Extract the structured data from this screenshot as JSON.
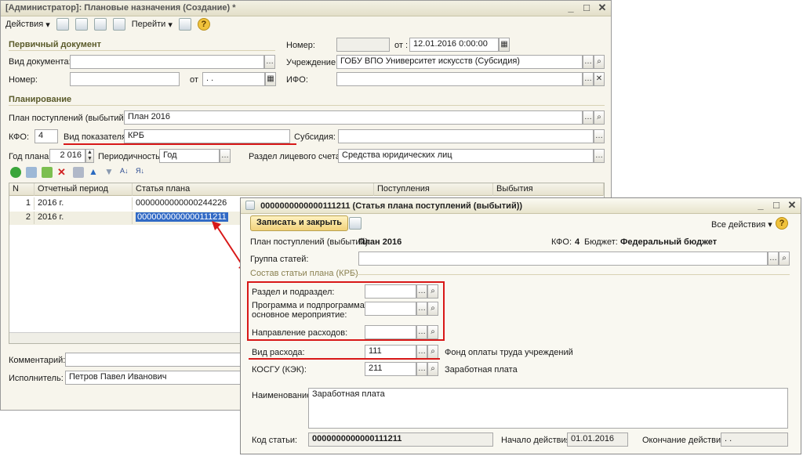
{
  "main_window": {
    "title": "[Администратор]: Плановые назначения (Создание) *",
    "toolbar": {
      "actions": "Действия",
      "go": "Перейти"
    },
    "primary_doc": {
      "section": "Первичный документ",
      "doc_type_label": "Вид документа:",
      "doc_type_value": "",
      "number_label": "Номер:",
      "number_value": "",
      "from_label": "от",
      "from_value": ". .",
      "num_label": "Номер:",
      "num_value": "",
      "ot_label": "от :",
      "date_value": "12.01.2016  0:00:00",
      "institution_label": "Учреждение:",
      "institution_value": "ГОБУ ВПО Университет искусств (Субсидия)",
      "ifo_label": "ИФО:",
      "ifo_value": ""
    },
    "planning": {
      "section": "Планирование",
      "plan_label": "План поступлений (выбытий):",
      "plan_value": "План 2016",
      "kfo_label": "КФО:",
      "kfo_value": "4",
      "indicator_label": "Вид показателя:",
      "indicator_value": "КРБ",
      "subsidy_label": "Субсидия:",
      "subsidy_value": "",
      "year_label": "Год плана:",
      "year_value": "2 016",
      "period_label": "Периодичность:",
      "period_value": "Год",
      "account_label": "Раздел лицевого счета:",
      "account_value": "Средства юридических лиц"
    },
    "table": {
      "headers": [
        "N",
        "Отчетный период",
        "Статья плана",
        "Поступления",
        "Выбытия"
      ],
      "rows": [
        {
          "n": "1",
          "period": "2016 г.",
          "article": "0000000000000244226"
        },
        {
          "n": "2",
          "period": "2016 г.",
          "article": "0000000000000111211"
        }
      ]
    },
    "comment_label": "Комментарий:",
    "comment_value": "",
    "executor_label": "Исполнитель:",
    "executor_value": "Петров Павел Иванович"
  },
  "dialog": {
    "title": "0000000000000111211 (Статья плана поступлений (выбытий))",
    "save_close": "Записать и закрыть",
    "all_actions": "Все действия",
    "plan_label": "План поступлений (выбытий):",
    "plan_value": "План 2016",
    "kfo_label": "КФО:",
    "kfo_value": "4",
    "budget_label": "Бюджет:",
    "budget_value": "Федеральный бюджет",
    "group_label": "Группа статей:",
    "group_value": "",
    "composition_section": "Состав статьи плана (КРБ)",
    "section_label": "Раздел и подраздел:",
    "section_value": "",
    "program_label_1": "Программа и подпрограмма,",
    "program_label_2": "основное мероприятие:",
    "program_value": "",
    "direction_label": "Направление расходов:",
    "direction_value": "",
    "expense_label": "Вид расхода:",
    "expense_value": "111",
    "expense_desc": "Фонд оплаты труда учреждений",
    "kosgu_label": "КОСГУ (КЭК):",
    "kosgu_value": "211",
    "kosgu_desc": "Заработная плата",
    "name_label": "Наименование:",
    "name_value": "Заработная плата",
    "code_label": "Код статьи:",
    "code_value": "0000000000000111211",
    "start_label": "Начало действия:",
    "start_value": "01.01.2016",
    "end_label": "Окончание действия:",
    "end_value": ". ."
  },
  "colors": {
    "accent_red": "#d81818",
    "selection": "#316ac5",
    "window_bg": "#f7f5ec"
  }
}
